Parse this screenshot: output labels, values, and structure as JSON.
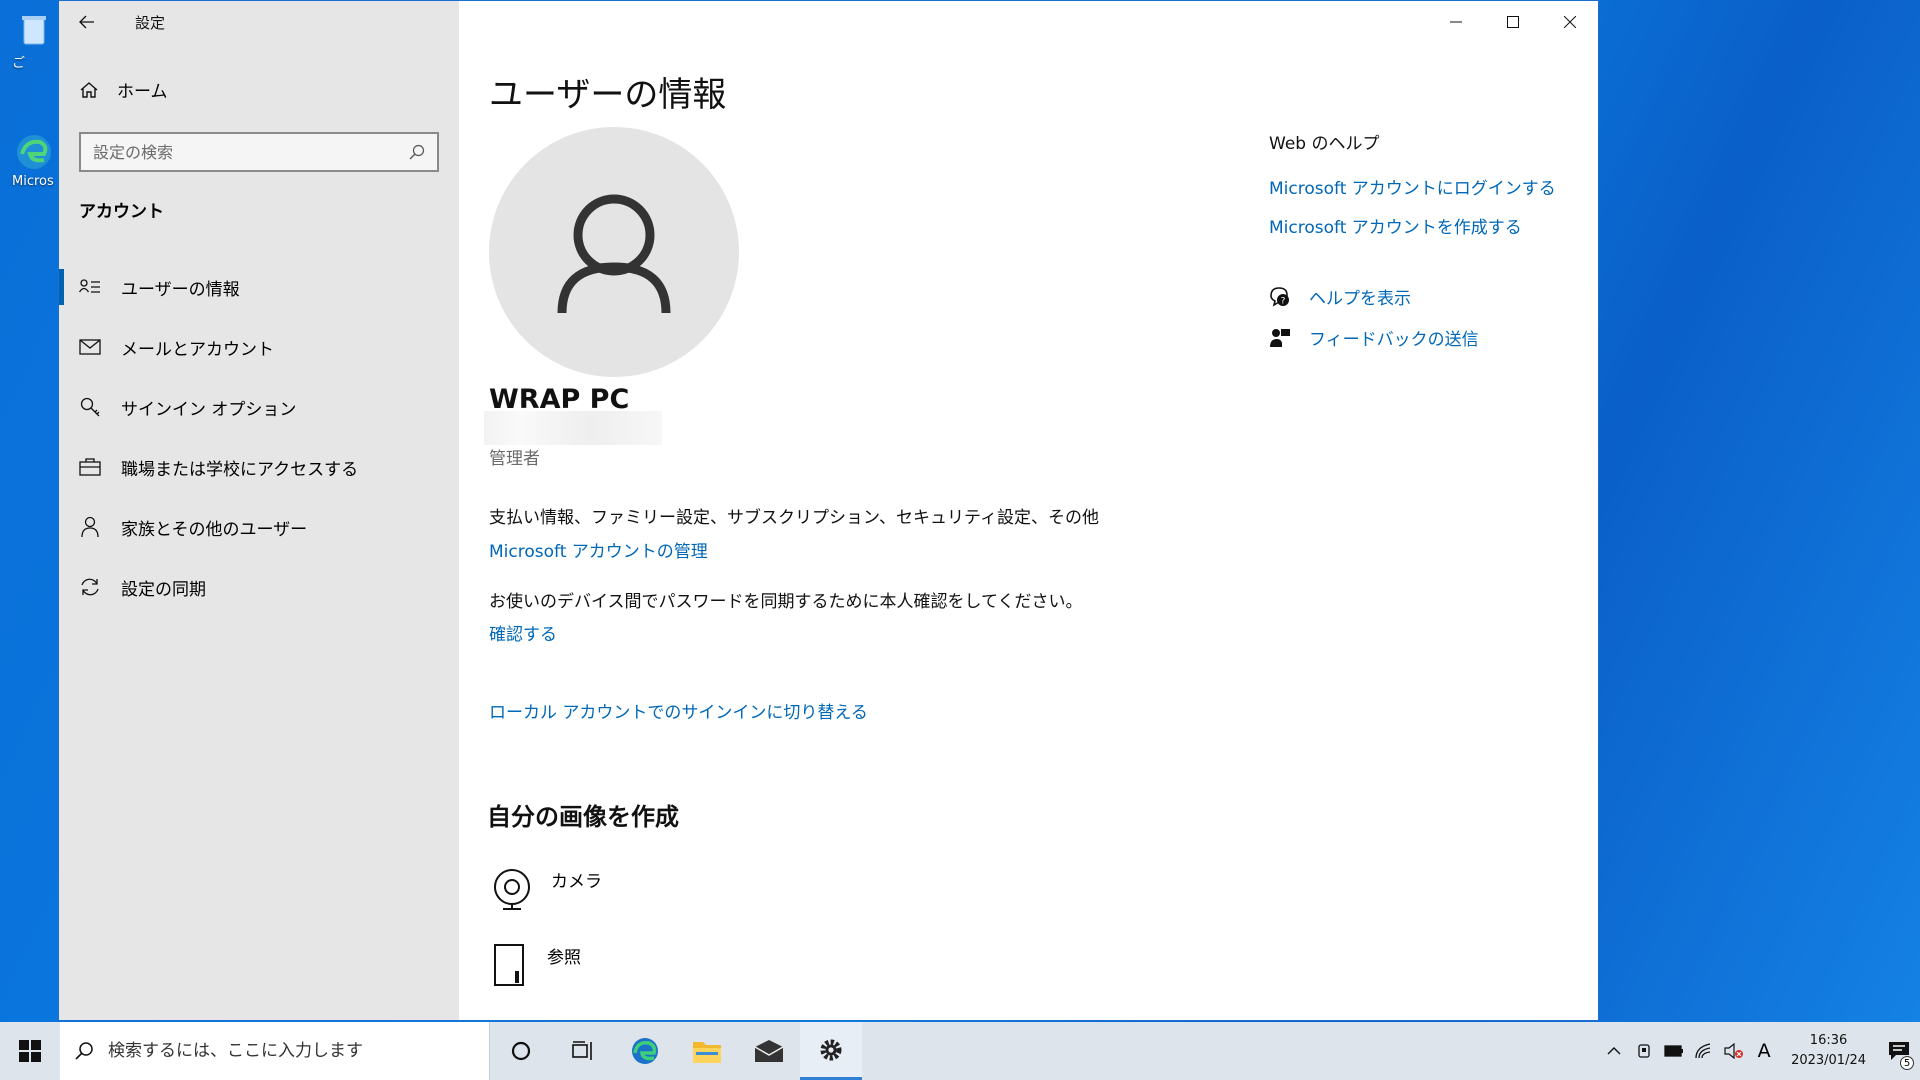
{
  "desktop": {
    "icons": [
      {
        "label": "ご"
      },
      {
        "label": "Micros"
      }
    ]
  },
  "window": {
    "app_title": "設定"
  },
  "sidebar": {
    "home_label": "ホーム",
    "search_placeholder": "設定の検索",
    "section_label": "アカウント",
    "items": [
      {
        "label": "ユーザーの情報",
        "icon": "user-info-icon",
        "active": true
      },
      {
        "label": "メールとアカウント",
        "icon": "mail-icon",
        "active": false
      },
      {
        "label": "サインイン オプション",
        "icon": "key-icon",
        "active": false
      },
      {
        "label": "職場または学校にアクセスする",
        "icon": "briefcase-icon",
        "active": false
      },
      {
        "label": "家族とその他のユーザー",
        "icon": "person-icon",
        "active": false
      },
      {
        "label": "設定の同期",
        "icon": "sync-icon",
        "active": false
      }
    ]
  },
  "main": {
    "title": "ユーザーの情報",
    "user_name": "WRAP PC",
    "role": "管理者",
    "billing_text": "支払い情報、ファミリー設定、サブスクリプション、セキュリティ設定、その他",
    "manage_link": "Microsoft アカウントの管理",
    "verify_text": "お使いのデバイス間でパスワードを同期するために本人確認をしてください。",
    "verify_link": "確認する",
    "local_switch_link": "ローカル アカウントでのサインインに切り替える",
    "create_picture_title": "自分の画像を作成",
    "create_options": [
      {
        "label": "カメラ",
        "icon": "camera-icon"
      },
      {
        "label": "参照",
        "icon": "browse-icon"
      }
    ]
  },
  "help": {
    "title": "Web のヘルプ",
    "links": [
      "Microsoft アカウントにログインする",
      "Microsoft アカウントを作成する"
    ],
    "get_help": "ヘルプを表示",
    "feedback": "フィードバックの送信"
  },
  "taskbar": {
    "search_placeholder": "検索するには、ここに入力します",
    "time": "16:36",
    "date": "2023/01/24",
    "ime": "A",
    "notification_count": "5"
  },
  "colors": {
    "accent": "#0067b8",
    "sidebar_bg": "#e6e6e6",
    "active_indicator": "#0063b1"
  }
}
